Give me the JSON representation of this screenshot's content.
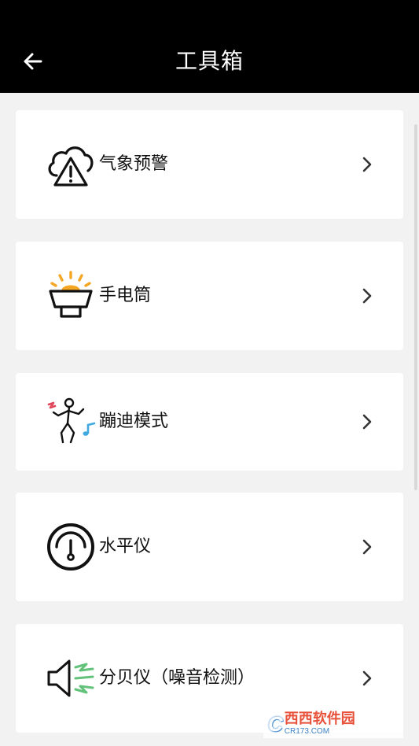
{
  "header": {
    "title": "工具箱",
    "back_icon": "arrow-left-icon"
  },
  "tools": [
    {
      "label": "气象预警",
      "icon": "weather-warning-icon"
    },
    {
      "label": "手电筒",
      "icon": "flashlight-icon"
    },
    {
      "label": "蹦迪模式",
      "icon": "dance-mode-icon"
    },
    {
      "label": "水平仪",
      "icon": "level-gauge-icon"
    },
    {
      "label": "分贝仪（噪音检测）",
      "icon": "decibel-meter-icon"
    }
  ],
  "chevron_icon": "chevron-right-icon",
  "watermark": {
    "logo": "C",
    "main": "西西软件园",
    "sub": "CR173.COM"
  },
  "colors": {
    "header_bg": "#000000",
    "page_bg": "#f2f2f2",
    "card_bg": "#ffffff",
    "flashlight_accent": "#f5a623",
    "dance_red": "#e0475b",
    "dance_blue": "#3fa9e0",
    "decibel_green": "#63c27a"
  }
}
